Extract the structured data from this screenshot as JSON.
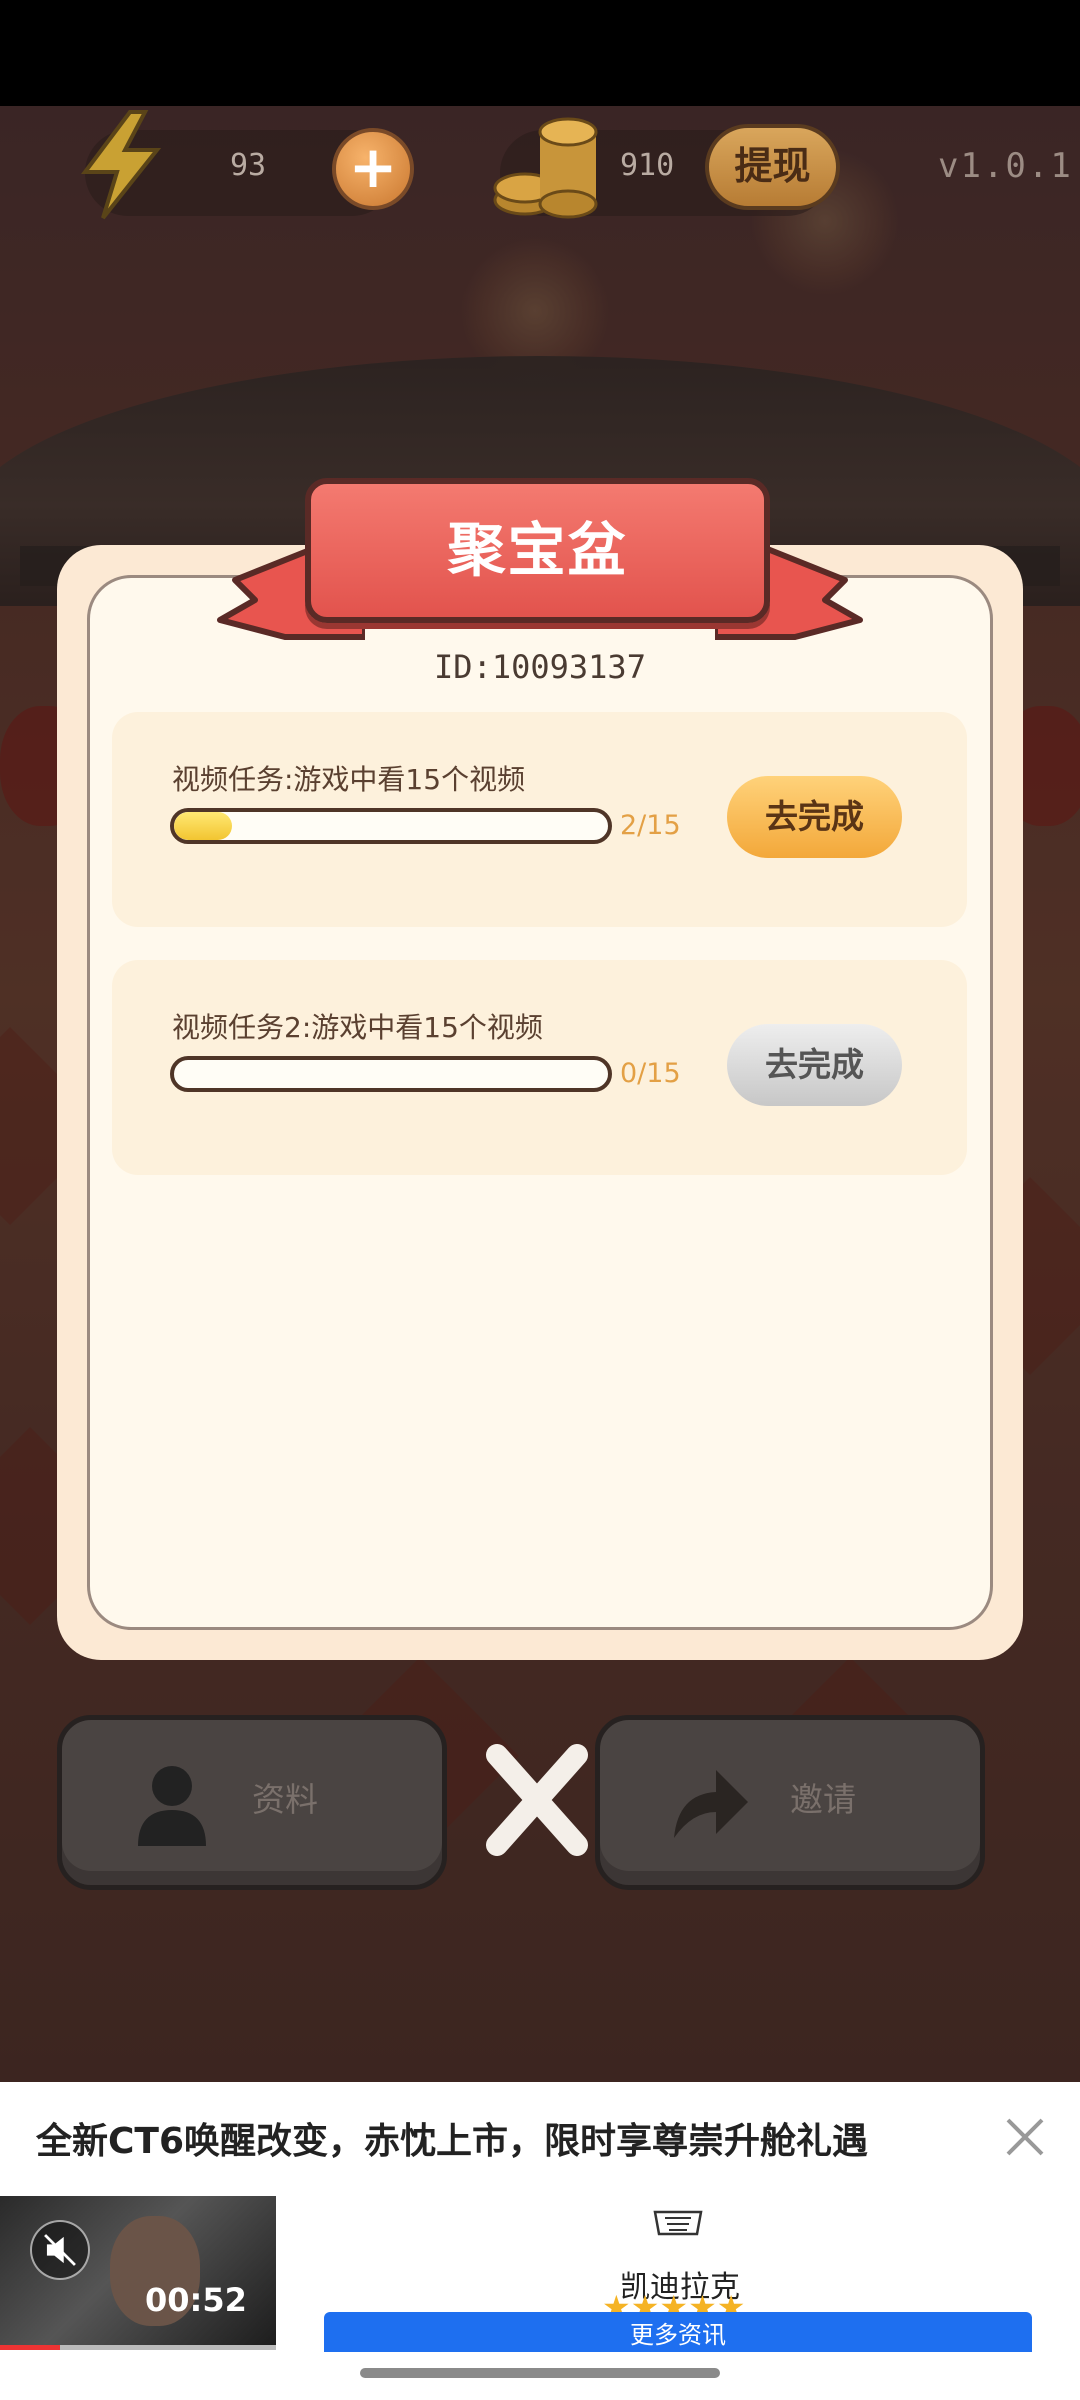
{
  "hud": {
    "energy_value": "93",
    "coins_value": "910",
    "withdraw_label": "提现",
    "version": "v1.0.1"
  },
  "dialog": {
    "title": "聚宝盆",
    "player_id": "ID:10093137",
    "tasks": [
      {
        "title": "视频任务:游戏中看15个视频",
        "progress_text": "2/15",
        "progress_fraction": 0.133,
        "button_label": "去完成",
        "button_state": "active"
      },
      {
        "title": "视频任务2:游戏中看15个视频",
        "progress_text": "0/15",
        "progress_fraction": 0,
        "button_label": "去完成",
        "button_state": "disabled"
      }
    ]
  },
  "bottom_bar": {
    "profile_label": "资料",
    "invite_label": "邀请"
  },
  "ad": {
    "title": "全新CT6唤醒改变，赤忱上市，限时享尊崇升舱礼遇",
    "video_time": "00:52",
    "brand_name": "凯迪拉克",
    "rating_stars": 5,
    "cta_label": "更多资讯"
  },
  "icons": {
    "energy": "lightning-icon",
    "plus": "plus-icon",
    "coins": "coins-icon",
    "profile": "person-icon",
    "invite": "share-arrow-icon",
    "close": "close-icon",
    "mute": "mute-icon",
    "ad_close": "ad-close-icon",
    "brand": "cadillac-logo-icon"
  },
  "colors": {
    "ribbon": "#e8554f",
    "progress_fill": "#f2c531",
    "active_button": "#f3a83a",
    "cta_blue": "#1e6ff0"
  }
}
